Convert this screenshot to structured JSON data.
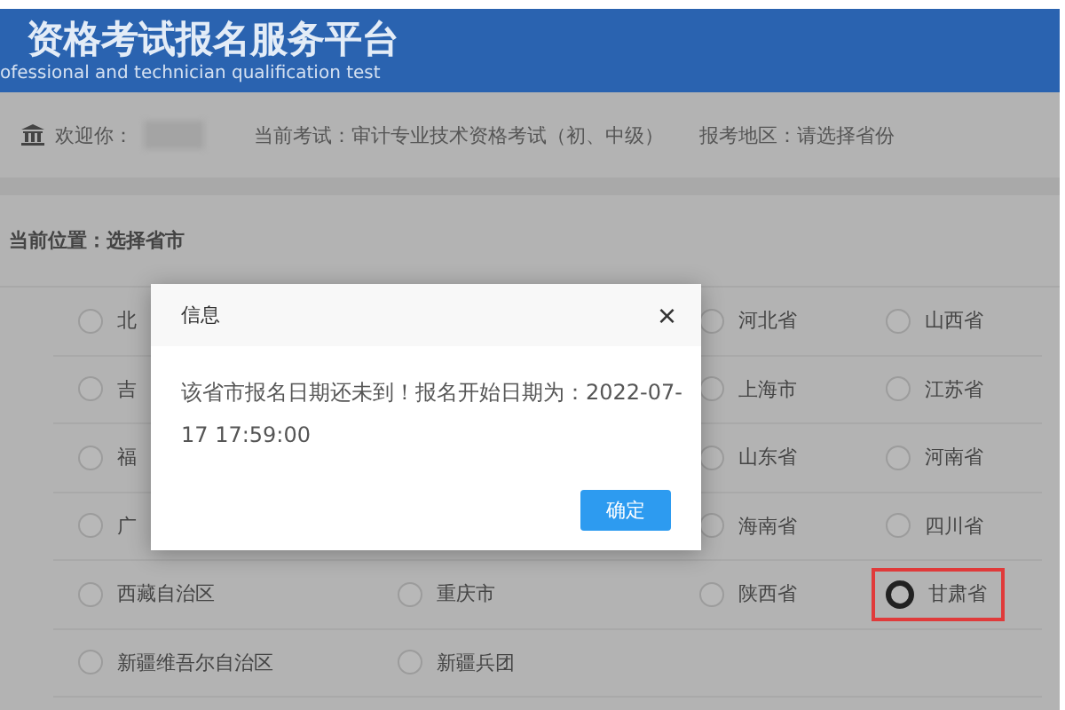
{
  "header": {
    "title": "资格考试报名服务平台",
    "subtitle": "ofessional and technician qualification test"
  },
  "info_bar": {
    "welcome": "欢迎你：",
    "exam": "当前考试：审计专业技术资格考试（初、中级）",
    "region": "报考地区：请选择省份"
  },
  "breadcrumb": "当前位置：选择省市",
  "rows": [
    {
      "cells": [
        {
          "kind": "radio",
          "label": "北",
          "selected": false,
          "highlighted": false
        },
        {
          "kind": "covered"
        },
        {
          "kind": "radio",
          "label": "河北省",
          "selected": false,
          "highlighted": false
        },
        {
          "kind": "radio",
          "label": "山西省",
          "selected": false,
          "highlighted": false
        }
      ]
    },
    {
      "cells": [
        {
          "kind": "radio",
          "label": "吉",
          "selected": false,
          "highlighted": false
        },
        {
          "kind": "covered"
        },
        {
          "kind": "radio",
          "label": "上海市",
          "selected": false,
          "highlighted": false
        },
        {
          "kind": "radio",
          "label": "江苏省",
          "selected": false,
          "highlighted": false
        }
      ]
    },
    {
      "cells": [
        {
          "kind": "radio",
          "label": "福",
          "selected": false,
          "highlighted": false
        },
        {
          "kind": "covered"
        },
        {
          "kind": "radio",
          "label": "山东省",
          "selected": false,
          "highlighted": false
        },
        {
          "kind": "radio",
          "label": "河南省",
          "selected": false,
          "highlighted": false
        }
      ]
    },
    {
      "cells": [
        {
          "kind": "radio",
          "label": "广",
          "selected": false,
          "highlighted": false
        },
        {
          "kind": "covered"
        },
        {
          "kind": "radio",
          "label": "海南省",
          "selected": false,
          "highlighted": false
        },
        {
          "kind": "radio",
          "label": "四川省",
          "selected": false,
          "highlighted": false
        }
      ]
    },
    {
      "cells": [
        {
          "kind": "radio",
          "label": "西藏自治区",
          "selected": false,
          "highlighted": false
        },
        {
          "kind": "radio",
          "label": "重庆市",
          "selected": false,
          "highlighted": false
        },
        {
          "kind": "radio",
          "label": "陕西省",
          "selected": false,
          "highlighted": false
        },
        {
          "kind": "radio",
          "label": "甘肃省",
          "selected": true,
          "highlighted": true
        }
      ]
    },
    {
      "cells": [
        {
          "kind": "radio",
          "label": "新疆维吾尔自治区",
          "selected": false,
          "highlighted": false
        },
        {
          "kind": "radio",
          "label": "新疆兵团",
          "selected": false,
          "highlighted": false
        }
      ]
    }
  ],
  "dialog": {
    "title": "信息",
    "close": "×",
    "message": "该省市报名日期还未到！报名开始日期为：2022-07-17 17:59:00",
    "button": "确定"
  }
}
